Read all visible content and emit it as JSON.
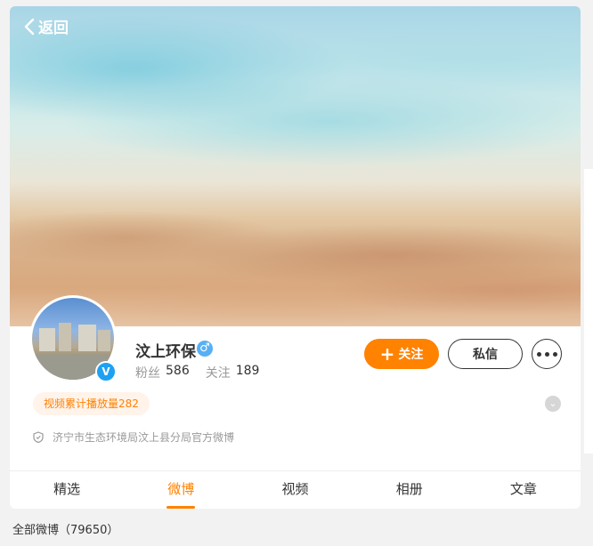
{
  "header": {
    "back_label": "返回"
  },
  "profile": {
    "name": "汶上环保",
    "gender_symbol": "♂",
    "verified_symbol": "V",
    "fans_label": "粉丝",
    "fans_count": "586",
    "following_label": "关注",
    "following_count": "189",
    "play_count_badge": "视频累计播放量282",
    "description": "济宁市生态环境局汶上县分局官方微博"
  },
  "actions": {
    "follow_label": "关注",
    "follow_icon": "plus-icon",
    "message_label": "私信",
    "more_icon": "ellipsis-icon"
  },
  "tabs": [
    {
      "label": "精选",
      "active": false
    },
    {
      "label": "微博",
      "active": true
    },
    {
      "label": "视频",
      "active": false
    },
    {
      "label": "相册",
      "active": false
    },
    {
      "label": "文章",
      "active": false
    }
  ],
  "feed": {
    "all_count_label": "全部微博（79650）"
  },
  "colors": {
    "accent": "#ff8200",
    "verified": "#1da1f2",
    "gender": "#58b0f4"
  }
}
